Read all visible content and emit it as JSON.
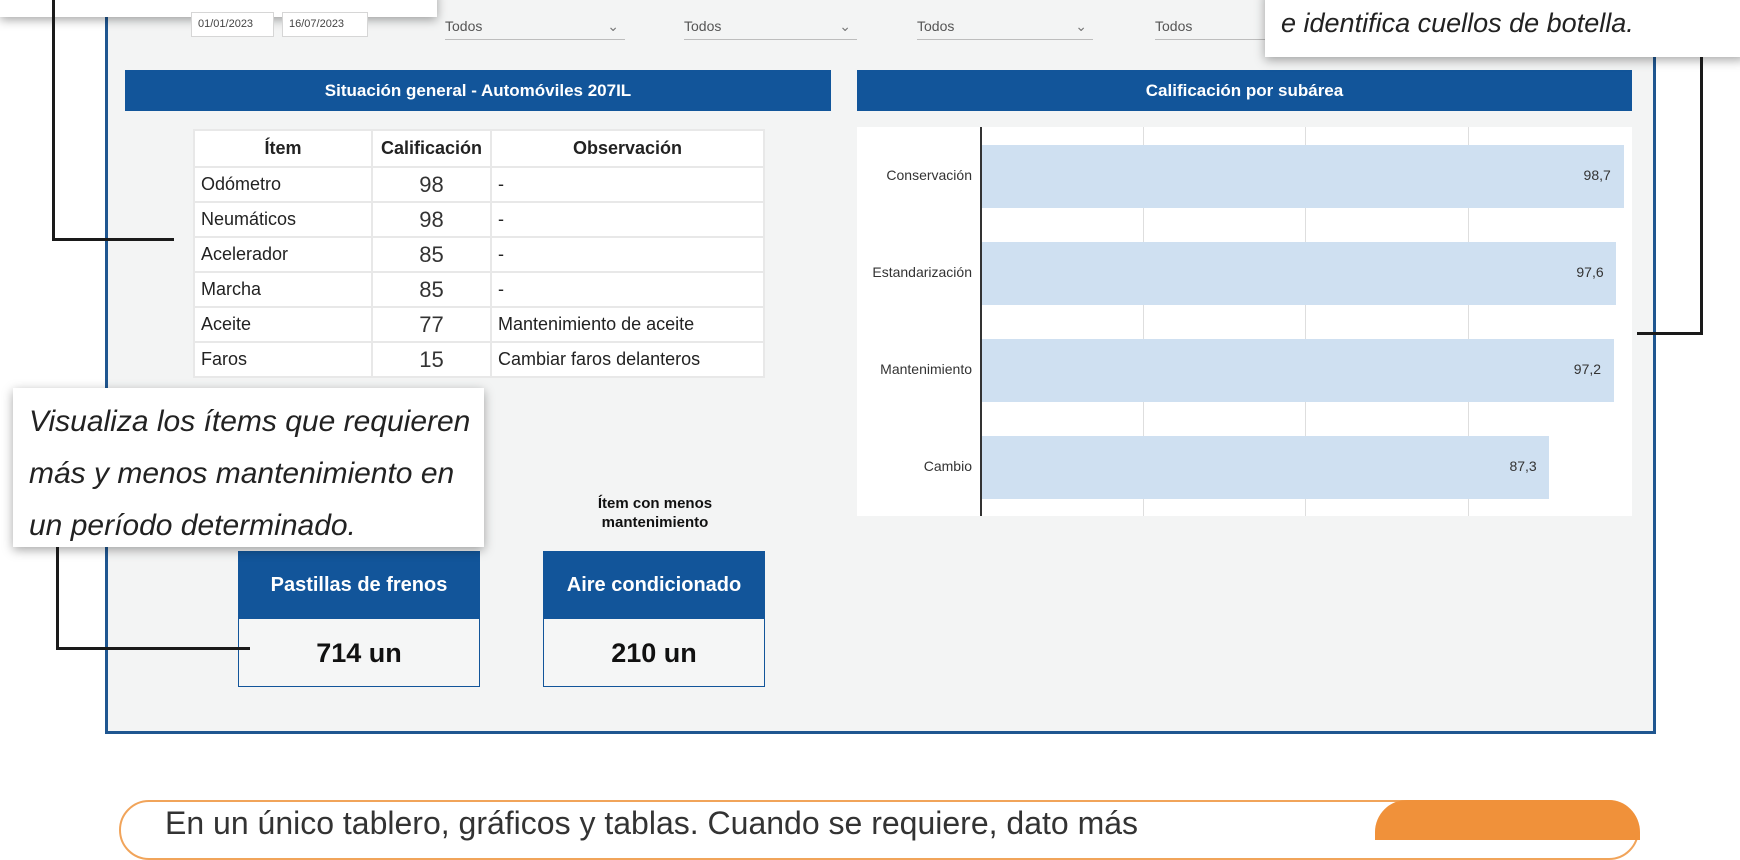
{
  "filters": {
    "date_start": "01/01/2023",
    "date_end": "16/07/2023",
    "dropdowns": [
      "Todos",
      "Todos",
      "Todos",
      "Todos"
    ]
  },
  "left_panel": {
    "title": "Situación general - Automóviles 207IL",
    "columns": [
      "Ítem",
      "Calificación",
      "Observación"
    ],
    "rows": [
      {
        "item": "Odómetro",
        "score": "98",
        "obs": "-"
      },
      {
        "item": "Neumáticos",
        "score": "98",
        "obs": "-"
      },
      {
        "item": "Acelerador",
        "score": "85",
        "obs": "-"
      },
      {
        "item": "Marcha",
        "score": "85",
        "obs": "-"
      },
      {
        "item": "Aceite",
        "score": "77",
        "obs": "Mantenimiento de aceite"
      },
      {
        "item": "Faros",
        "score": "15",
        "obs": "Cambiar faros delanteros"
      }
    ]
  },
  "right_panel": {
    "title": "Calificación por subárea"
  },
  "chart_data": {
    "type": "bar",
    "orientation": "horizontal",
    "categories": [
      "Conservación",
      "Estandarización",
      "Mantenimiento",
      "Cambio"
    ],
    "values": [
      98.7,
      97.6,
      97.2,
      87.3
    ],
    "value_labels": [
      "98,7",
      "97,6",
      "97,2",
      "87,3"
    ],
    "xlim": [
      0,
      100
    ],
    "grid": true,
    "bar_color": "#cfe0f1"
  },
  "kpis": [
    {
      "caption": "",
      "label": "Pastillas de frenos",
      "value": "714 un"
    },
    {
      "caption": "Ítem con menos mantenimiento",
      "label": "Aire condicionado",
      "value": "210 un"
    }
  ],
  "callouts": {
    "top_right": "e identifica cuellos de botella.",
    "left_lines": [
      "Visualiza los ítems que requieren",
      "más y menos mantenimiento en",
      "un período determinado."
    ]
  },
  "banner": {
    "text": "En un único tablero, gráficos y tablas. Cuando se requiere, dato más"
  },
  "colors": {
    "accent": "#12559a",
    "banner_accent": "#f0913a"
  }
}
